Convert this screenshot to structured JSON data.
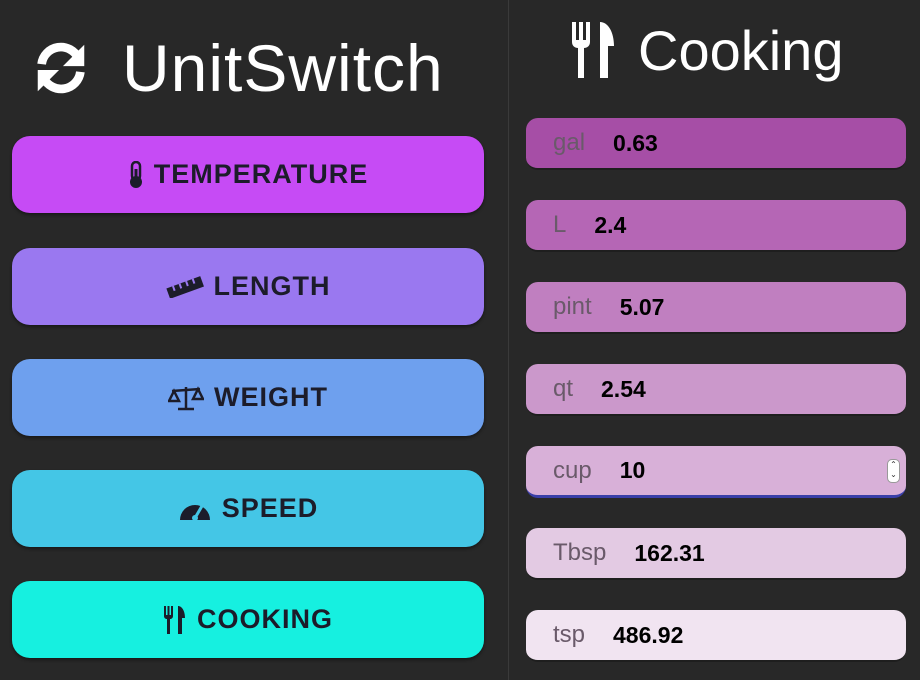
{
  "app": {
    "title": "UnitSwitch",
    "logo_icon": "sync-icon"
  },
  "categories": [
    {
      "label": "TEMPERATURE",
      "icon": "thermometer-icon",
      "color": "#c64bf5"
    },
    {
      "label": "LENGTH",
      "icon": "ruler-icon",
      "color": "#9a78f0"
    },
    {
      "label": "WEIGHT",
      "icon": "balance-scale-icon",
      "color": "#6ea0ee"
    },
    {
      "label": "SPEED",
      "icon": "speedometer-icon",
      "color": "#44c6e6"
    },
    {
      "label": "COOKING",
      "icon": "utensils-icon",
      "color": "#16f0e0"
    }
  ],
  "section": {
    "title": "Cooking",
    "icon": "utensils-icon"
  },
  "fields": [
    {
      "unit": "gal",
      "value": "0.63",
      "color": "#a64ea6"
    },
    {
      "unit": "L",
      "value": "2.4",
      "color": "#b566b5"
    },
    {
      "unit": "pint",
      "value": "5.07",
      "color": "#c07fc0"
    },
    {
      "unit": "qt",
      "value": "2.54",
      "color": "#cb98cb"
    },
    {
      "unit": "cup",
      "value": "10",
      "color": "#d8b0d8"
    },
    {
      "unit": "Tbsp",
      "value": "162.31",
      "color": "#e3cae3"
    },
    {
      "unit": "tsp",
      "value": "486.92",
      "color": "#f1e4f1"
    }
  ]
}
